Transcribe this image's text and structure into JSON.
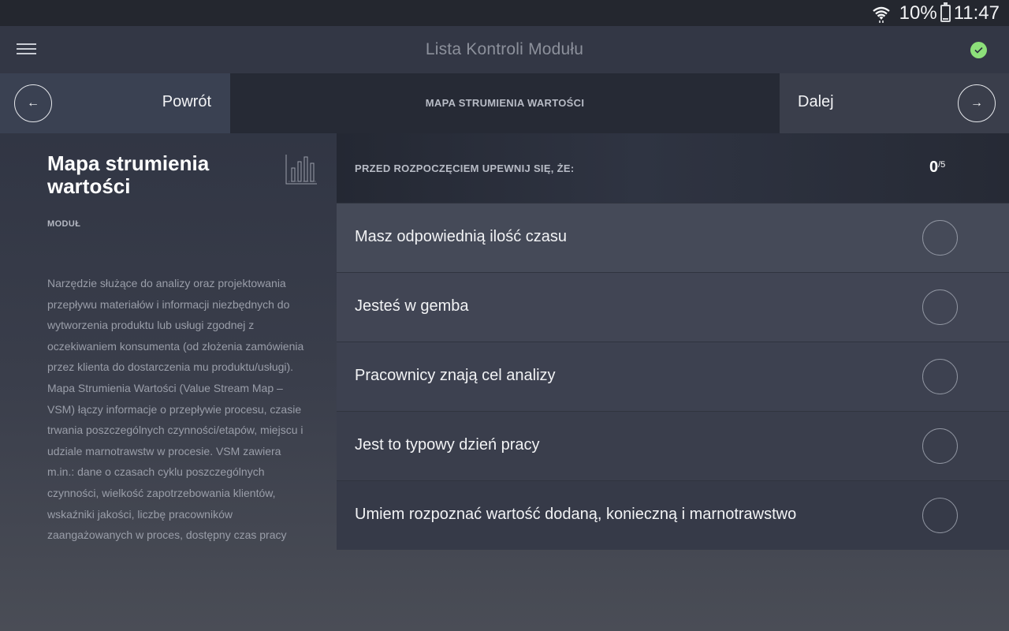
{
  "status_bar": {
    "battery_percent": "10%",
    "time": "11:47"
  },
  "header": {
    "title": "Lista Kontroli Modułu"
  },
  "nav": {
    "back_label": "Powrót",
    "title": "MAPA STRUMIENIA WARTOŚCI",
    "next_label": "Dalej",
    "back_arrow": "←",
    "next_arrow": "→"
  },
  "module": {
    "title": "Mapa strumienia wartości",
    "kicker": "MODUŁ",
    "description": "Narzędzie służące do analizy oraz projektowania przepływu materiałów i informacji niezbędnych do wytworzenia produktu lub usługi zgodnej z oczekiwaniem konsumenta (od złożenia zamówienia przez klienta do dostarczenia mu produktu/usługi). Mapa Strumienia Wartości (Value Stream Map – VSM) łączy informacje o przepływie procesu, czasie trwania poszczególnych czynności/etapów, miejscu i udziale marnotrawstw w procesie. VSM zawiera m.in.: dane o czasach cyklu poszczególnych czynności, wielkość zapotrzebowania klientów, wskaźniki jakości, liczbę pracowników zaangażowanych w proces, dostępny czas pracy",
    "icon": "bar-chart-icon"
  },
  "checklist": {
    "heading": "PRZED ROZPOCZĘCIEM UPEWNIJ SIĘ, ŻE:",
    "done": "0",
    "total": "/5",
    "items": [
      {
        "label": "Masz odpowiednią ilość czasu",
        "checked": false
      },
      {
        "label": "Jesteś w gemba",
        "checked": false
      },
      {
        "label": "Pracownicy znają cel analizy",
        "checked": false
      },
      {
        "label": "Jest to typowy dzień pracy",
        "checked": false
      },
      {
        "label": "Umiem rozpoznać wartość dodaną, konieczną i marnotrawstwo",
        "checked": false
      }
    ]
  },
  "colors": {
    "accent_check": "#8de07a",
    "background": "#2c3140"
  }
}
